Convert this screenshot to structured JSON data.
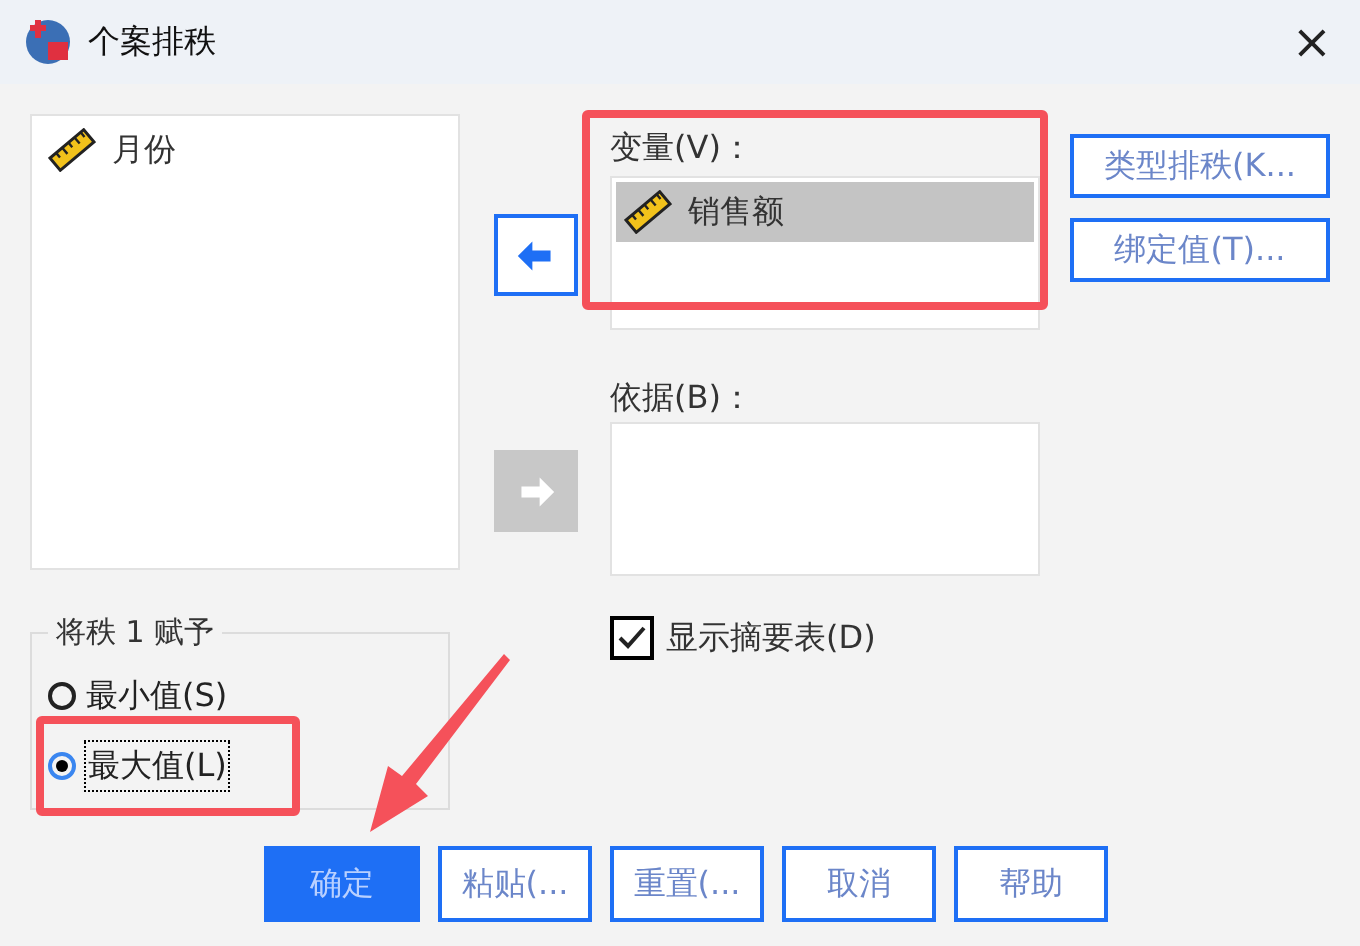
{
  "window": {
    "title": "个案排秩",
    "close": "×"
  },
  "source_list": {
    "items": [
      {
        "label": "月份",
        "selected": false
      }
    ]
  },
  "move_buttons": [
    {
      "kind": "left",
      "disabled": false
    },
    {
      "kind": "right",
      "disabled": true
    }
  ],
  "variable": {
    "label": "变量(V)：",
    "items": [
      {
        "label": "销售额",
        "selected": true
      }
    ]
  },
  "by": {
    "label": "依据(B)："
  },
  "side_buttons": [
    {
      "label": "类型排秩(K..."
    },
    {
      "label": "绑定值(T)..."
    }
  ],
  "assign_rank": {
    "title": "将秩 1 赋予",
    "options": [
      {
        "label": "最小值(S)",
        "selected": false
      },
      {
        "label": "最大值(L)",
        "selected": true
      }
    ]
  },
  "summary": {
    "label": "显示摘要表(D)",
    "checked": true
  },
  "buttons": [
    {
      "label": "确定",
      "default": true
    },
    {
      "label": "粘贴(...",
      "default": false
    },
    {
      "label": "重置(...",
      "default": false
    },
    {
      "label": "取消",
      "default": false
    },
    {
      "label": "帮助",
      "default": false
    }
  ]
}
